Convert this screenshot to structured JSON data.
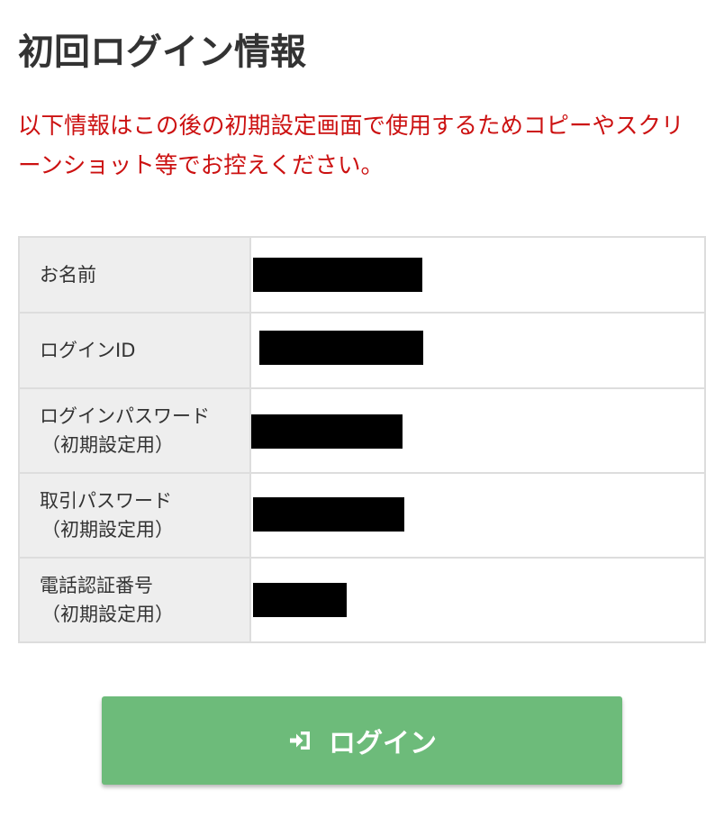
{
  "page": {
    "title": "初回ログイン情報",
    "notice": "以下情報はこの後の初期設定画面で使用するためコピーやスクリーンショット等でお控えください。"
  },
  "info_table": {
    "rows": [
      {
        "label": "お名前",
        "sub_label": "",
        "value": ""
      },
      {
        "label": "ログインID",
        "sub_label": "",
        "value": ""
      },
      {
        "label": "ログインパスワード",
        "sub_label": "（初期設定用）",
        "value": ""
      },
      {
        "label": "取引パスワード",
        "sub_label": "（初期設定用）",
        "value": ""
      },
      {
        "label": "電話認証番号",
        "sub_label": "（初期設定用）",
        "value": ""
      }
    ]
  },
  "login_button": {
    "label": "ログイン",
    "icon": "sign-in-icon"
  },
  "colors": {
    "notice_text": "#cc1111",
    "button_background": "#6dbb7a",
    "table_header_background": "#eeeeee",
    "table_border": "#dddddd",
    "redaction": "#000000"
  }
}
